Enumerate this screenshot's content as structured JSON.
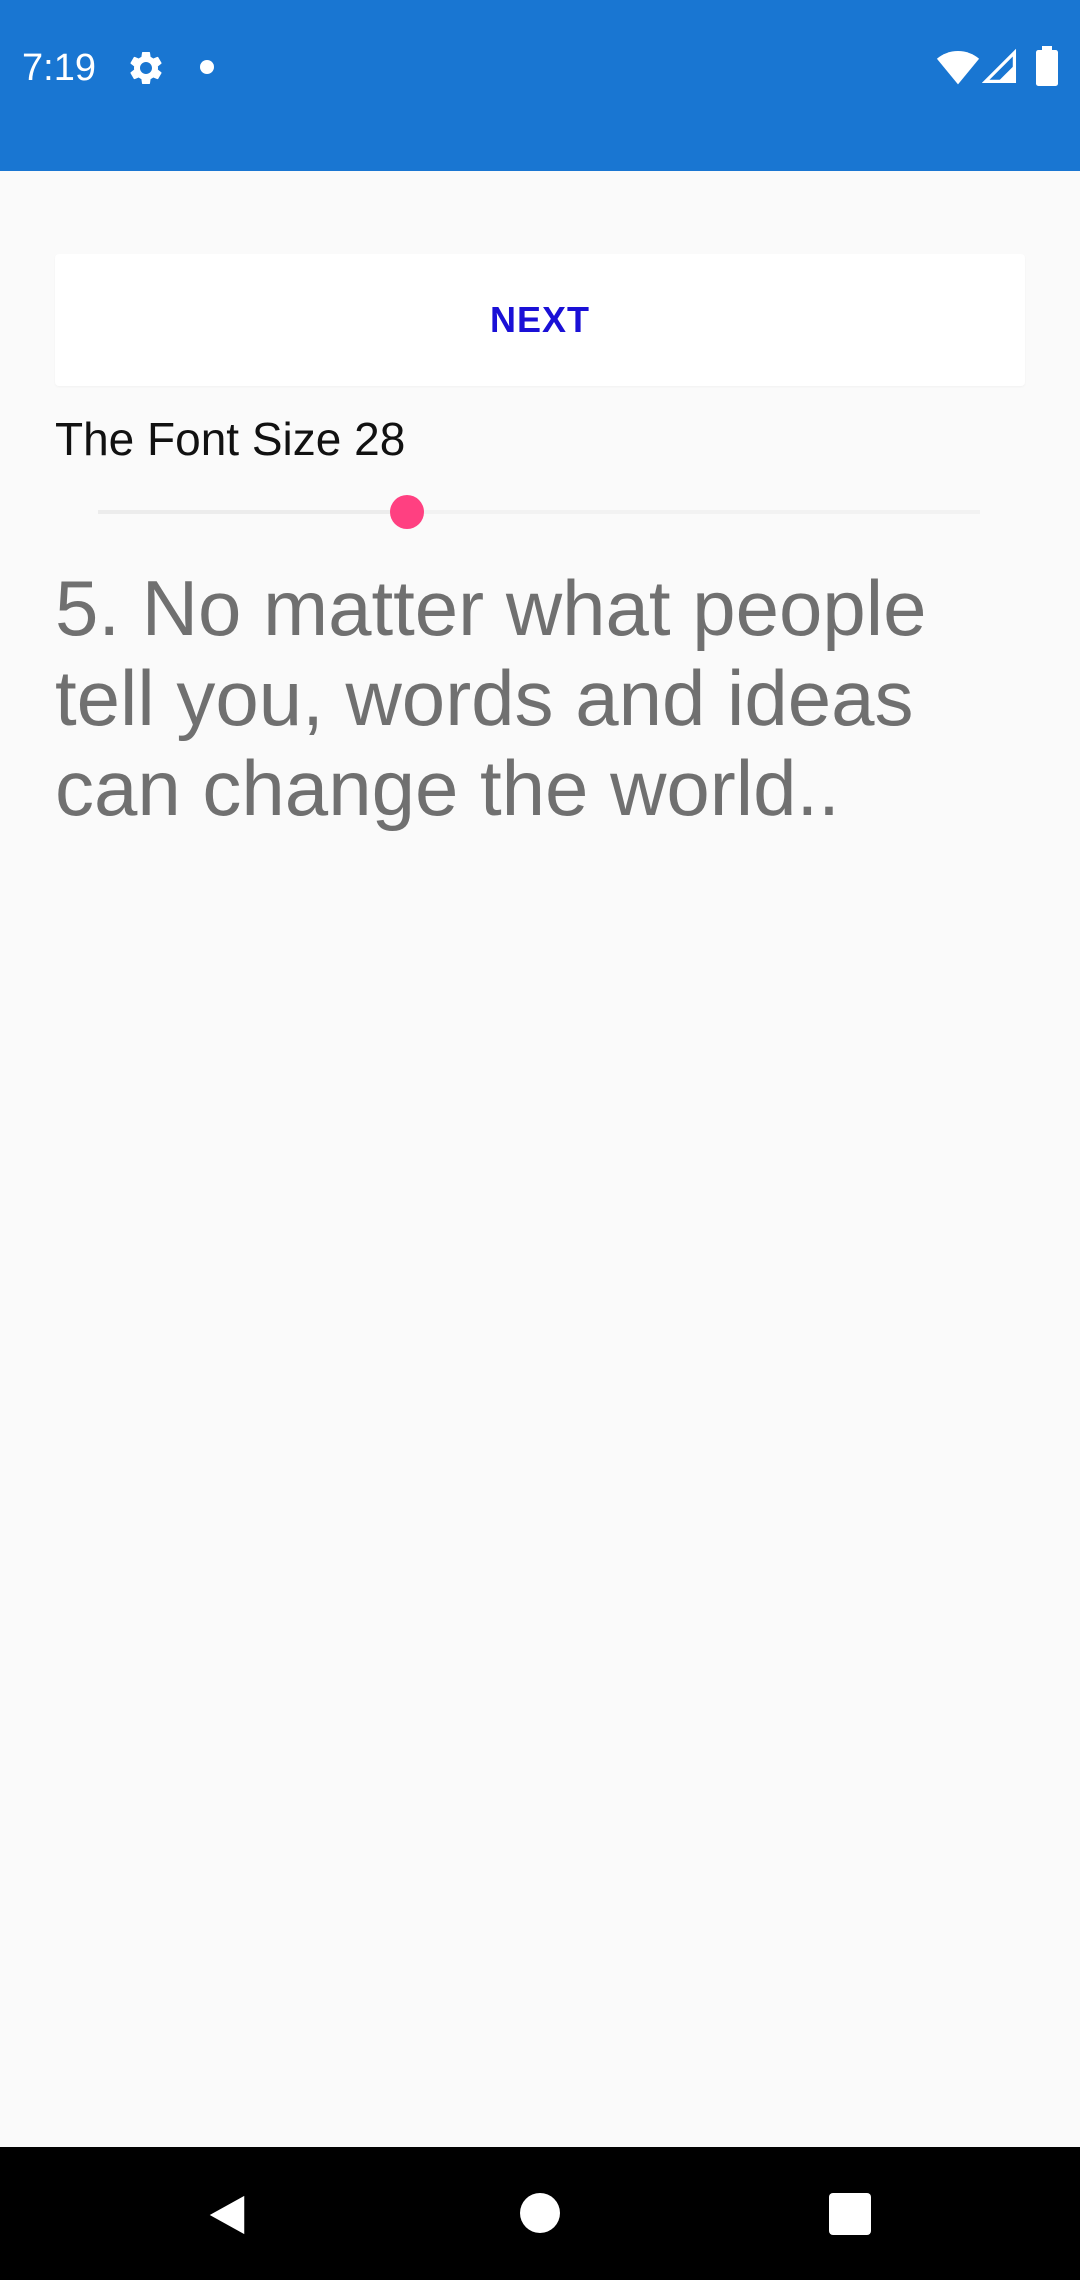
{
  "status_bar": {
    "time": "7:19",
    "background": "#1976d2",
    "icons": [
      "gear-icon",
      "notification-dot-icon",
      "wifi-icon",
      "cell-signal-icon",
      "battery-icon"
    ]
  },
  "main": {
    "next_label": "NEXT",
    "next_color": "#1a10d6",
    "font_size_label": "The Font Size 28",
    "slider": {
      "value_fraction": 0.35,
      "thumb_color": "#ff4081"
    },
    "quote": "5. No matter what people tell you, words and ideas can change the world..",
    "quote_color": "#707070"
  },
  "nav_bar": {
    "icons": [
      "back-icon",
      "home-icon",
      "recents-icon"
    ]
  }
}
